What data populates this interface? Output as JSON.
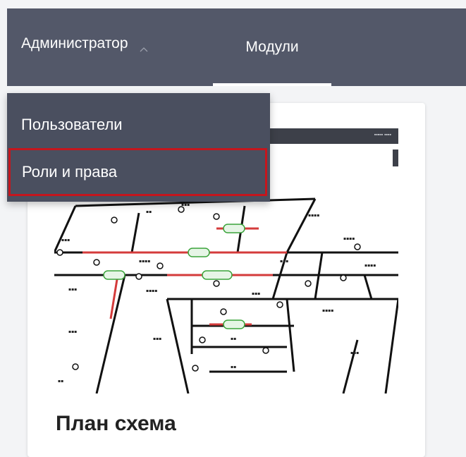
{
  "nav": {
    "admin_label": "Администратор",
    "modules_label": "Модули",
    "active_tab_color": "#ffffff",
    "bar_color": "#535869"
  },
  "dropdown": {
    "items": [
      {
        "label": "Пользователи"
      },
      {
        "label": "Роли и права",
        "highlighted": true,
        "highlight_color": "#c5161d"
      }
    ]
  },
  "card": {
    "title": "План схема"
  }
}
